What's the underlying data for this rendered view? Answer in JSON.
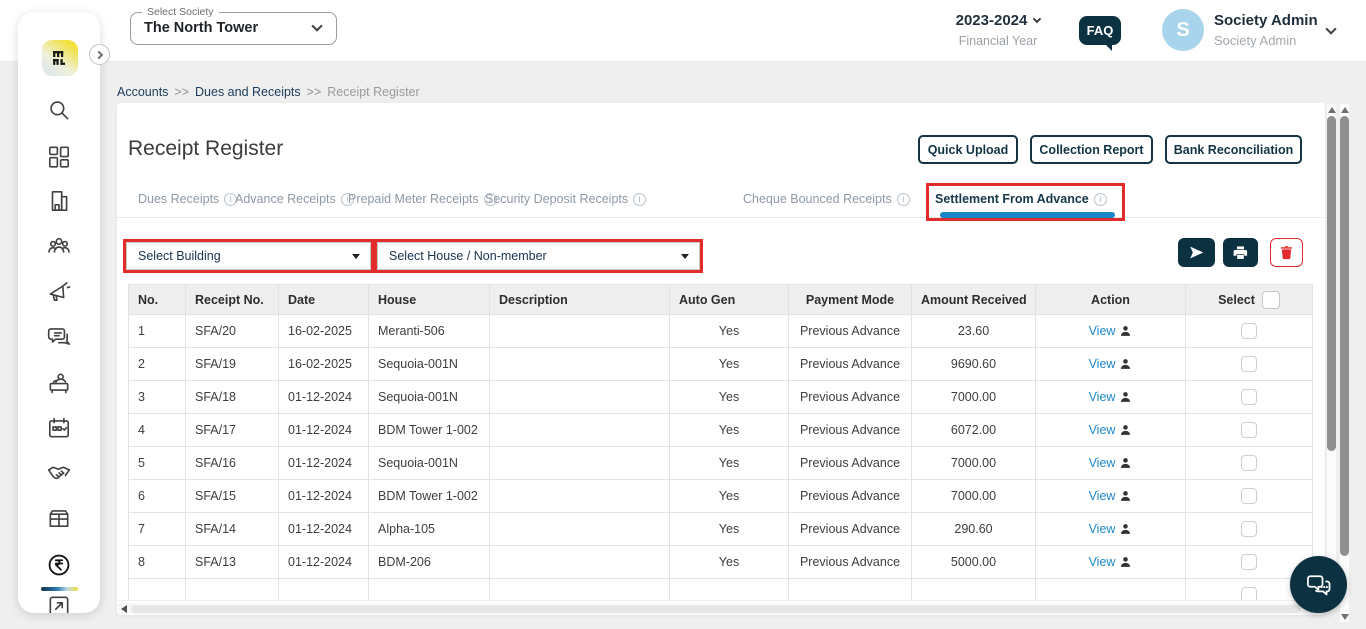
{
  "topbar": {
    "society_label": "Select Society",
    "society_value": "The North Tower",
    "financial_year": "2023-2024",
    "financial_year_label": "Financial Year",
    "faq": "FAQ",
    "user": {
      "initial": "S",
      "name": "Society Admin",
      "role": "Society Admin"
    }
  },
  "breadcrumb": {
    "separator": ">>",
    "items": [
      {
        "label": "Accounts",
        "current": false
      },
      {
        "label": "Dues and Receipts",
        "current": false
      },
      {
        "label": "Receipt Register",
        "current": true
      }
    ]
  },
  "sidebar": {
    "items": [
      {
        "name": "app-logo",
        "icon": "logo",
        "active": false
      },
      {
        "name": "search",
        "icon": "search",
        "active": false
      },
      {
        "name": "dashboard",
        "icon": "dashboard",
        "active": false
      },
      {
        "name": "society-buildings",
        "icon": "building",
        "active": false
      },
      {
        "name": "community",
        "icon": "people",
        "active": false
      },
      {
        "name": "announcements",
        "icon": "megaphone",
        "active": false
      },
      {
        "name": "communications",
        "icon": "chat",
        "active": false
      },
      {
        "name": "front-desk",
        "icon": "helpdesk",
        "active": false
      },
      {
        "name": "calendar-bookings",
        "icon": "calendar",
        "active": false
      },
      {
        "name": "vendors",
        "icon": "handshake",
        "active": false
      },
      {
        "name": "inventory",
        "icon": "box",
        "active": false
      },
      {
        "name": "accounts",
        "icon": "rupee",
        "active": true
      },
      {
        "name": "approvals",
        "icon": "tasks",
        "active": false
      }
    ]
  },
  "page": {
    "title": "Receipt Register",
    "actions": [
      "Quick Upload",
      "Collection Report",
      "Bank Reconciliation"
    ],
    "tabs": [
      {
        "label": "Dues Receipts",
        "active": false
      },
      {
        "label": "Advance Receipts",
        "active": false
      },
      {
        "label": "Prepaid Meter Receipts",
        "active": false
      },
      {
        "label": "Security Deposit Receipts",
        "active": false
      },
      {
        "label": "Cheque Bounced Receipts",
        "active": false
      },
      {
        "label": "Settlement From Advance",
        "active": true
      }
    ],
    "info_glyph": "i",
    "filters": {
      "building_placeholder": "Select Building",
      "house_placeholder": "Select House / Non-member"
    }
  },
  "table": {
    "columns": [
      "No.",
      "Receipt No.",
      "Date",
      "House",
      "Description",
      "Auto Gen",
      "Payment Mode",
      "Amount Received",
      "Action",
      "Select"
    ],
    "view_label": "View",
    "rows": [
      {
        "no": "1",
        "receipt_no": "SFA/20",
        "date": "16-02-2025",
        "house": "Meranti-506",
        "description": "",
        "auto_gen": "Yes",
        "payment_mode": "Previous Advance",
        "amount_received": "23.60"
      },
      {
        "no": "2",
        "receipt_no": "SFA/19",
        "date": "16-02-2025",
        "house": "Sequoia-001N",
        "description": "",
        "auto_gen": "Yes",
        "payment_mode": "Previous Advance",
        "amount_received": "9690.60"
      },
      {
        "no": "3",
        "receipt_no": "SFA/18",
        "date": "01-12-2024",
        "house": "Sequoia-001N",
        "description": "",
        "auto_gen": "Yes",
        "payment_mode": "Previous Advance",
        "amount_received": "7000.00"
      },
      {
        "no": "4",
        "receipt_no": "SFA/17",
        "date": "01-12-2024",
        "house": "BDM Tower 1-002",
        "description": "",
        "auto_gen": "Yes",
        "payment_mode": "Previous Advance",
        "amount_received": "6072.00"
      },
      {
        "no": "5",
        "receipt_no": "SFA/16",
        "date": "01-12-2024",
        "house": "Sequoia-001N",
        "description": "",
        "auto_gen": "Yes",
        "payment_mode": "Previous Advance",
        "amount_received": "7000.00"
      },
      {
        "no": "6",
        "receipt_no": "SFA/15",
        "date": "01-12-2024",
        "house": "BDM Tower 1-002",
        "description": "",
        "auto_gen": "Yes",
        "payment_mode": "Previous Advance",
        "amount_received": "7000.00"
      },
      {
        "no": "7",
        "receipt_no": "SFA/14",
        "date": "01-12-2024",
        "house": "Alpha-105",
        "description": "",
        "auto_gen": "Yes",
        "payment_mode": "Previous Advance",
        "amount_received": "290.60"
      },
      {
        "no": "8",
        "receipt_no": "SFA/13",
        "date": "01-12-2024",
        "house": "BDM-206",
        "description": "",
        "auto_gen": "Yes",
        "payment_mode": "Previous Advance",
        "amount_received": "5000.00"
      }
    ]
  },
  "colors": {
    "annotation_red": "#e22b2b",
    "active_tab_underline": "#1787c8",
    "dark_teal": "#0c3140",
    "link_blue": "#1e88c7",
    "avatar_bg": "#a8d4ec"
  }
}
